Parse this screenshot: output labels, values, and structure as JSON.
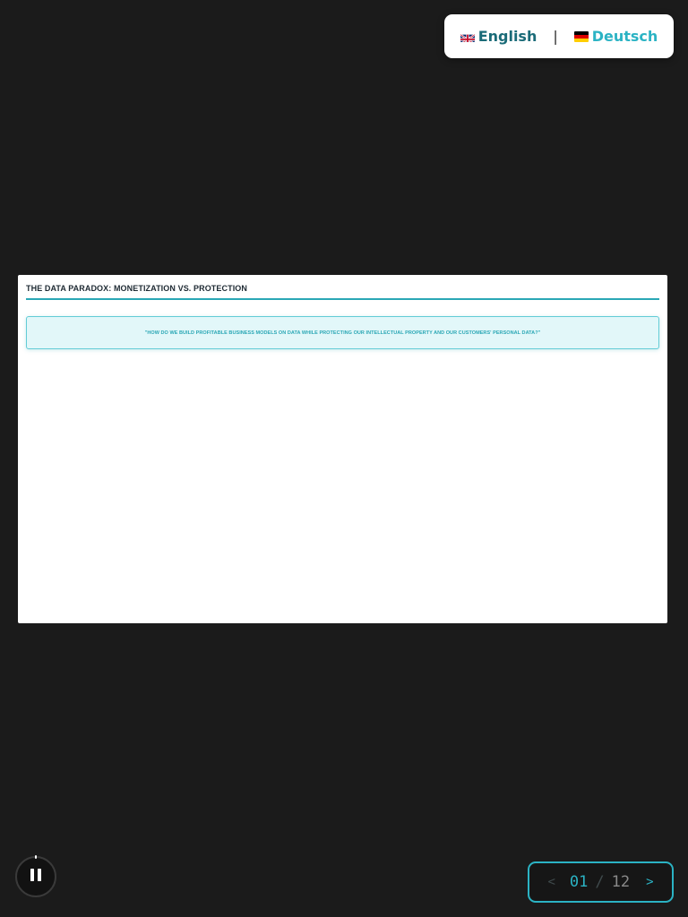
{
  "language_switcher": {
    "english_label": "English",
    "separator": "|",
    "deutsch_label": "Deutsch",
    "active": "English"
  },
  "slide": {
    "title": "THE DATA PARADOX: MONETIZATION VS. PROTECTION",
    "question": "\"HOW DO WE BUILD PROFITABLE BUSINESS MODELS ON DATA WHILE PROTECTING OUR INTELLECTUAL PROPERTY AND OUR CUSTOMERS' PERSONAL DATA?\""
  },
  "player": {
    "state": "playing",
    "control_icon": "pause-icon"
  },
  "pagination": {
    "prev_label": "<",
    "current": "01",
    "separator": "/",
    "total": "12",
    "next_label": ">"
  },
  "colors": {
    "accent": "#2bb3c4",
    "accent_dark": "#1a6b78",
    "background": "#1b1b1b",
    "slide_background": "#ffffff"
  }
}
